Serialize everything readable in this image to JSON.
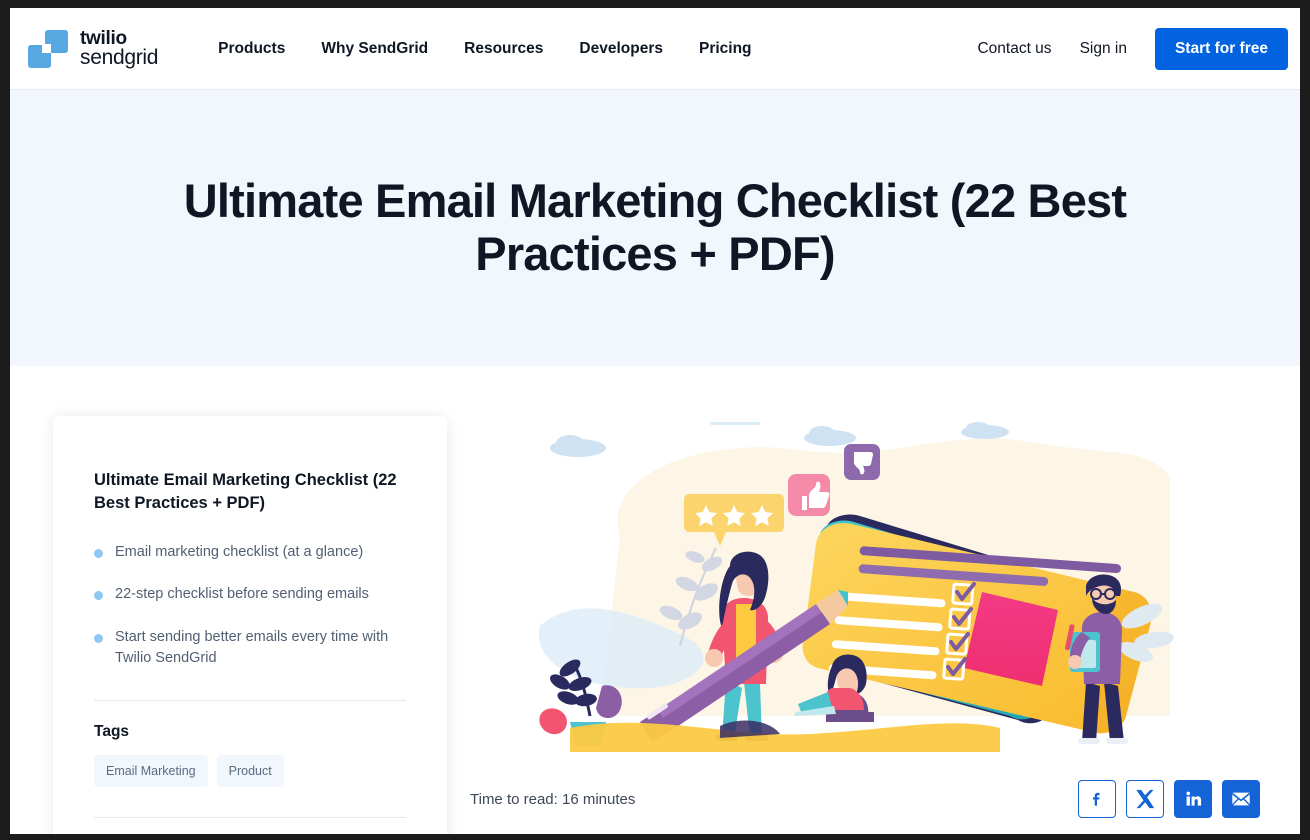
{
  "brand": {
    "logo_line1": "twilio",
    "logo_line2": "sendgrid",
    "logo_color": "#57a7e0",
    "accent_color": "#0263e0",
    "hero_bg": "#f1f7fd",
    "text_color": "#0f1724"
  },
  "nav": {
    "primary": [
      {
        "label": "Products"
      },
      {
        "label": "Why SendGrid"
      },
      {
        "label": "Resources"
      },
      {
        "label": "Developers"
      },
      {
        "label": "Pricing"
      }
    ],
    "secondary": [
      {
        "label": "Contact us"
      },
      {
        "label": "Sign in"
      }
    ],
    "cta_label": "Start for free"
  },
  "hero": {
    "title": "Ultimate Email Marketing Checklist (22 Best Practices + PDF)"
  },
  "sidebar_card": {
    "title": "Ultimate Email Marketing Checklist (22 Best Practices + PDF)",
    "bullets": [
      {
        "text": "Email marketing checklist (at a glance)"
      },
      {
        "text": "22-step checklist before sending emails"
      },
      {
        "text": "Start sending better emails every time with Twilio SendGrid"
      }
    ],
    "bullet_color": "#8ec8f2",
    "tags_heading": "Tags",
    "tags": [
      {
        "label": "Email Marketing"
      },
      {
        "label": "Product"
      }
    ]
  },
  "article_meta": {
    "read_time": "Time to read: 16 minutes",
    "share": [
      {
        "name": "facebook-share-button",
        "glyph": "f",
        "style": "outline"
      },
      {
        "name": "x-share-button",
        "glyph": "X",
        "style": "outline"
      },
      {
        "name": "linkedin-share-button",
        "glyph": "in",
        "style": "solid"
      },
      {
        "name": "email-share-button",
        "glyph": "envelope",
        "style": "solid"
      }
    ]
  },
  "illustration": {
    "alt": "Flat illustration of people with a giant checklist, pencil, stars, thumbs up and thumbs down badges",
    "colors": {
      "cream": "#fdf6e3",
      "yellow": "#fcc942",
      "yellow_dark": "#f8b72c",
      "navy": "#2b2a5e",
      "teal": "#2fb9c4",
      "pink": "#ef3d7c",
      "purple": "#8b5ea6",
      "cloud": "#cfe2f3",
      "coral": "#f5617a"
    }
  }
}
